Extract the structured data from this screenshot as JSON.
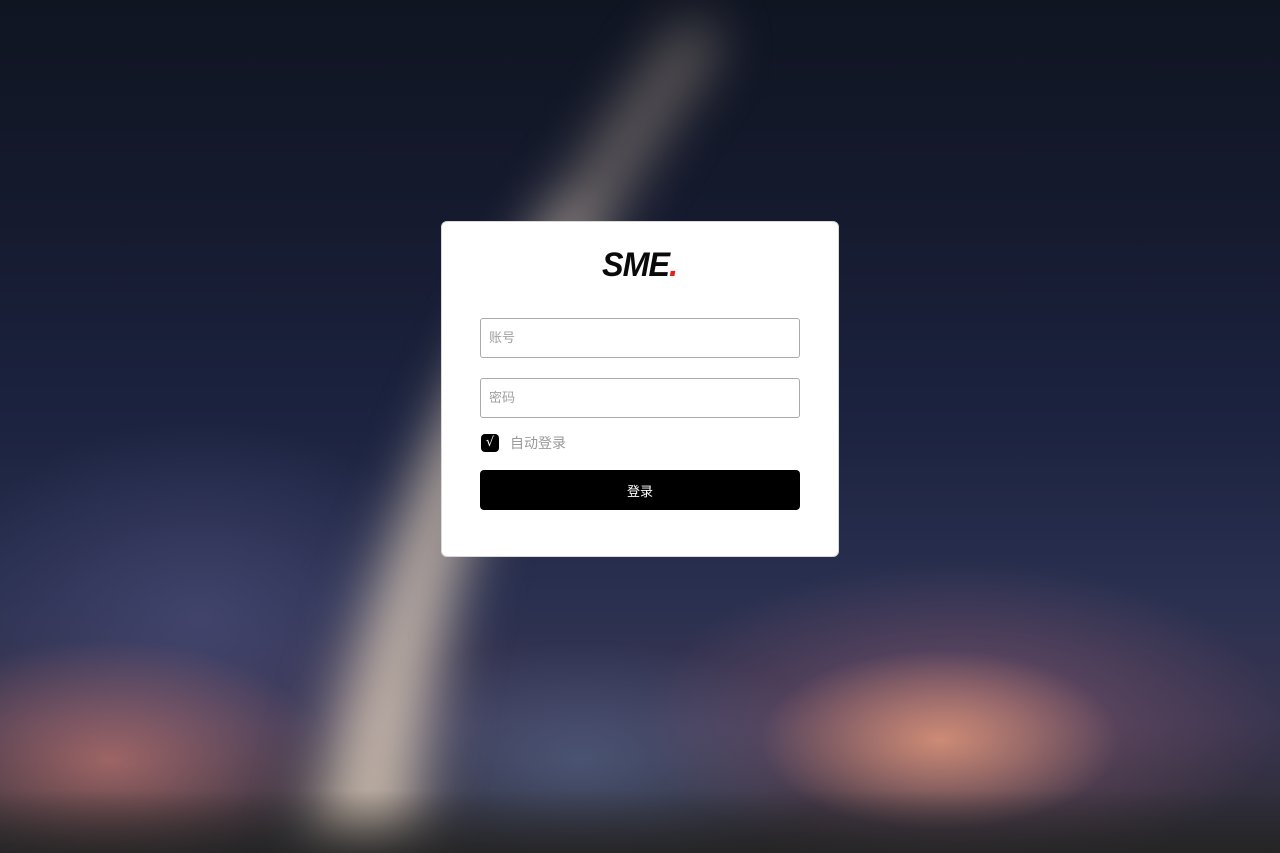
{
  "logo": {
    "text": "SME",
    "dot": "."
  },
  "form": {
    "account": {
      "placeholder": "账号",
      "value": ""
    },
    "password": {
      "placeholder": "密码",
      "value": ""
    },
    "remember": {
      "checked": true,
      "checkmark": "√",
      "label": "自动登录"
    },
    "submit_label": "登录"
  },
  "colors": {
    "accent_dot": "#e2231a",
    "button_bg": "#000000",
    "card_bg": "#ffffff"
  }
}
